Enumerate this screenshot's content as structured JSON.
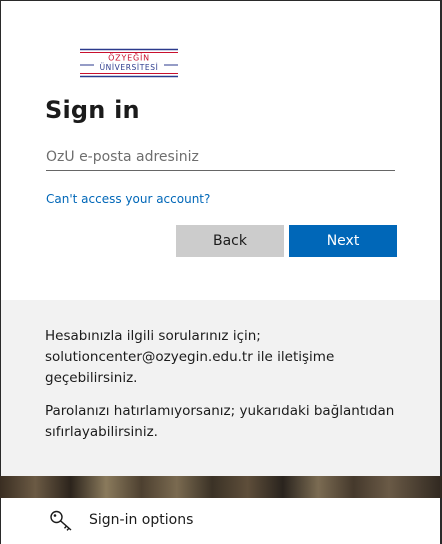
{
  "logo": {
    "line1": "ÖZYEĞİN",
    "line2": "ÜNİVERSİTESİ",
    "colors": {
      "blue": "#2b3a8c",
      "red": "#c8102e"
    }
  },
  "signin": {
    "title": "Sign in",
    "email_placeholder": "OzU e-posta adresiniz",
    "email_value": "",
    "access_link": "Can't access your account?",
    "back_label": "Back",
    "next_label": "Next"
  },
  "info": {
    "paragraph1": "Hesabınızla ilgili sorularınız için; solutioncenter@ozyegin.edu.tr ile iletişime geçebilirsiniz.",
    "paragraph2": "Parolanızı hatırlamıyorsanız; yukarıdaki bağlantıdan sıfırlayabilirsiniz."
  },
  "footer": {
    "options_label": "Sign-in options",
    "icon": "key-icon"
  },
  "colors": {
    "accent": "#0067b8",
    "back_button": "#cccccc",
    "info_panel": "#f2f2f2"
  }
}
